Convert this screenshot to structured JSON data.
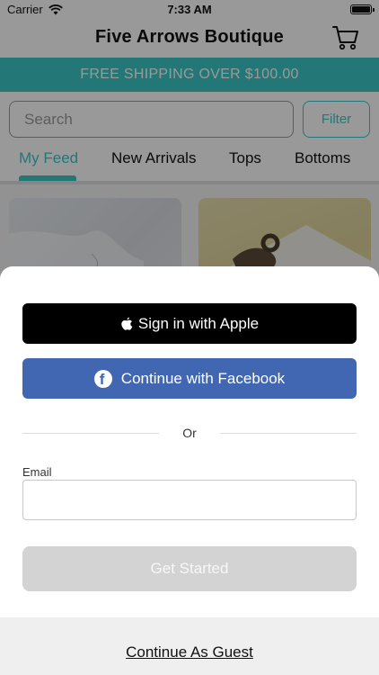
{
  "status_bar": {
    "carrier": "Carrier",
    "time": "7:33 AM"
  },
  "header": {
    "title": "Five Arrows Boutique",
    "cart_icon": "cart-icon"
  },
  "promo_banner": "FREE SHIPPING OVER $100.00",
  "search": {
    "placeholder": "Search",
    "filter_label": "Filter"
  },
  "tabs": [
    {
      "label": "My Feed",
      "active": true
    },
    {
      "label": "New Arrivals",
      "active": false
    },
    {
      "label": "Tops",
      "active": false
    },
    {
      "label": "Bottoms",
      "active": false
    }
  ],
  "sheet": {
    "apple_label": "Sign in with Apple",
    "facebook_label": "Continue with Facebook",
    "or_label": "Or",
    "email_label": "Email",
    "email_value": "",
    "get_started_label": "Get Started",
    "guest_label": "Continue As Guest"
  },
  "colors": {
    "accent": "#3cc6c6",
    "facebook": "#4267b2",
    "apple": "#000000",
    "disabled": "#d3d3d3"
  }
}
